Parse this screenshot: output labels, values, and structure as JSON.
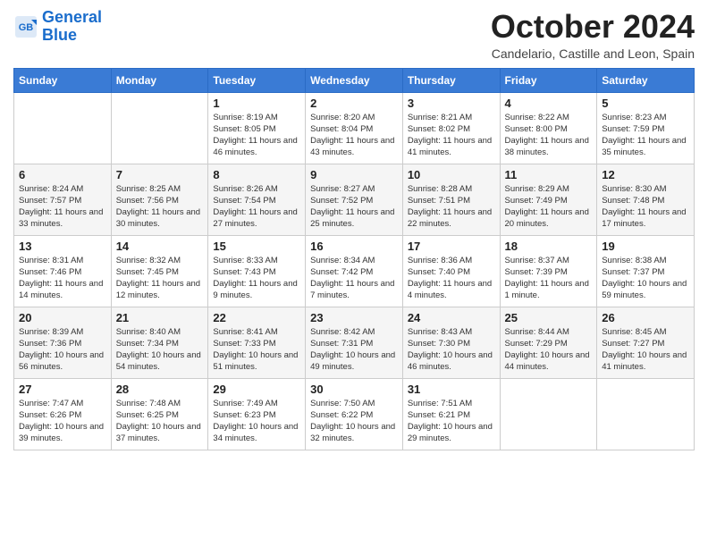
{
  "logo": {
    "line1": "General",
    "line2": "Blue"
  },
  "header": {
    "month": "October 2024",
    "location": "Candelario, Castille and Leon, Spain"
  },
  "weekdays": [
    "Sunday",
    "Monday",
    "Tuesday",
    "Wednesday",
    "Thursday",
    "Friday",
    "Saturday"
  ],
  "weeks": [
    [
      {
        "day": "",
        "sunrise": "",
        "sunset": "",
        "daylight": ""
      },
      {
        "day": "",
        "sunrise": "",
        "sunset": "",
        "daylight": ""
      },
      {
        "day": "1",
        "sunrise": "Sunrise: 8:19 AM",
        "sunset": "Sunset: 8:05 PM",
        "daylight": "Daylight: 11 hours and 46 minutes."
      },
      {
        "day": "2",
        "sunrise": "Sunrise: 8:20 AM",
        "sunset": "Sunset: 8:04 PM",
        "daylight": "Daylight: 11 hours and 43 minutes."
      },
      {
        "day": "3",
        "sunrise": "Sunrise: 8:21 AM",
        "sunset": "Sunset: 8:02 PM",
        "daylight": "Daylight: 11 hours and 41 minutes."
      },
      {
        "day": "4",
        "sunrise": "Sunrise: 8:22 AM",
        "sunset": "Sunset: 8:00 PM",
        "daylight": "Daylight: 11 hours and 38 minutes."
      },
      {
        "day": "5",
        "sunrise": "Sunrise: 8:23 AM",
        "sunset": "Sunset: 7:59 PM",
        "daylight": "Daylight: 11 hours and 35 minutes."
      }
    ],
    [
      {
        "day": "6",
        "sunrise": "Sunrise: 8:24 AM",
        "sunset": "Sunset: 7:57 PM",
        "daylight": "Daylight: 11 hours and 33 minutes."
      },
      {
        "day": "7",
        "sunrise": "Sunrise: 8:25 AM",
        "sunset": "Sunset: 7:56 PM",
        "daylight": "Daylight: 11 hours and 30 minutes."
      },
      {
        "day": "8",
        "sunrise": "Sunrise: 8:26 AM",
        "sunset": "Sunset: 7:54 PM",
        "daylight": "Daylight: 11 hours and 27 minutes."
      },
      {
        "day": "9",
        "sunrise": "Sunrise: 8:27 AM",
        "sunset": "Sunset: 7:52 PM",
        "daylight": "Daylight: 11 hours and 25 minutes."
      },
      {
        "day": "10",
        "sunrise": "Sunrise: 8:28 AM",
        "sunset": "Sunset: 7:51 PM",
        "daylight": "Daylight: 11 hours and 22 minutes."
      },
      {
        "day": "11",
        "sunrise": "Sunrise: 8:29 AM",
        "sunset": "Sunset: 7:49 PM",
        "daylight": "Daylight: 11 hours and 20 minutes."
      },
      {
        "day": "12",
        "sunrise": "Sunrise: 8:30 AM",
        "sunset": "Sunset: 7:48 PM",
        "daylight": "Daylight: 11 hours and 17 minutes."
      }
    ],
    [
      {
        "day": "13",
        "sunrise": "Sunrise: 8:31 AM",
        "sunset": "Sunset: 7:46 PM",
        "daylight": "Daylight: 11 hours and 14 minutes."
      },
      {
        "day": "14",
        "sunrise": "Sunrise: 8:32 AM",
        "sunset": "Sunset: 7:45 PM",
        "daylight": "Daylight: 11 hours and 12 minutes."
      },
      {
        "day": "15",
        "sunrise": "Sunrise: 8:33 AM",
        "sunset": "Sunset: 7:43 PM",
        "daylight": "Daylight: 11 hours and 9 minutes."
      },
      {
        "day": "16",
        "sunrise": "Sunrise: 8:34 AM",
        "sunset": "Sunset: 7:42 PM",
        "daylight": "Daylight: 11 hours and 7 minutes."
      },
      {
        "day": "17",
        "sunrise": "Sunrise: 8:36 AM",
        "sunset": "Sunset: 7:40 PM",
        "daylight": "Daylight: 11 hours and 4 minutes."
      },
      {
        "day": "18",
        "sunrise": "Sunrise: 8:37 AM",
        "sunset": "Sunset: 7:39 PM",
        "daylight": "Daylight: 11 hours and 1 minute."
      },
      {
        "day": "19",
        "sunrise": "Sunrise: 8:38 AM",
        "sunset": "Sunset: 7:37 PM",
        "daylight": "Daylight: 10 hours and 59 minutes."
      }
    ],
    [
      {
        "day": "20",
        "sunrise": "Sunrise: 8:39 AM",
        "sunset": "Sunset: 7:36 PM",
        "daylight": "Daylight: 10 hours and 56 minutes."
      },
      {
        "day": "21",
        "sunrise": "Sunrise: 8:40 AM",
        "sunset": "Sunset: 7:34 PM",
        "daylight": "Daylight: 10 hours and 54 minutes."
      },
      {
        "day": "22",
        "sunrise": "Sunrise: 8:41 AM",
        "sunset": "Sunset: 7:33 PM",
        "daylight": "Daylight: 10 hours and 51 minutes."
      },
      {
        "day": "23",
        "sunrise": "Sunrise: 8:42 AM",
        "sunset": "Sunset: 7:31 PM",
        "daylight": "Daylight: 10 hours and 49 minutes."
      },
      {
        "day": "24",
        "sunrise": "Sunrise: 8:43 AM",
        "sunset": "Sunset: 7:30 PM",
        "daylight": "Daylight: 10 hours and 46 minutes."
      },
      {
        "day": "25",
        "sunrise": "Sunrise: 8:44 AM",
        "sunset": "Sunset: 7:29 PM",
        "daylight": "Daylight: 10 hours and 44 minutes."
      },
      {
        "day": "26",
        "sunrise": "Sunrise: 8:45 AM",
        "sunset": "Sunset: 7:27 PM",
        "daylight": "Daylight: 10 hours and 41 minutes."
      }
    ],
    [
      {
        "day": "27",
        "sunrise": "Sunrise: 7:47 AM",
        "sunset": "Sunset: 6:26 PM",
        "daylight": "Daylight: 10 hours and 39 minutes."
      },
      {
        "day": "28",
        "sunrise": "Sunrise: 7:48 AM",
        "sunset": "Sunset: 6:25 PM",
        "daylight": "Daylight: 10 hours and 37 minutes."
      },
      {
        "day": "29",
        "sunrise": "Sunrise: 7:49 AM",
        "sunset": "Sunset: 6:23 PM",
        "daylight": "Daylight: 10 hours and 34 minutes."
      },
      {
        "day": "30",
        "sunrise": "Sunrise: 7:50 AM",
        "sunset": "Sunset: 6:22 PM",
        "daylight": "Daylight: 10 hours and 32 minutes."
      },
      {
        "day": "31",
        "sunrise": "Sunrise: 7:51 AM",
        "sunset": "Sunset: 6:21 PM",
        "daylight": "Daylight: 10 hours and 29 minutes."
      },
      {
        "day": "",
        "sunrise": "",
        "sunset": "",
        "daylight": ""
      },
      {
        "day": "",
        "sunrise": "",
        "sunset": "",
        "daylight": ""
      }
    ]
  ]
}
